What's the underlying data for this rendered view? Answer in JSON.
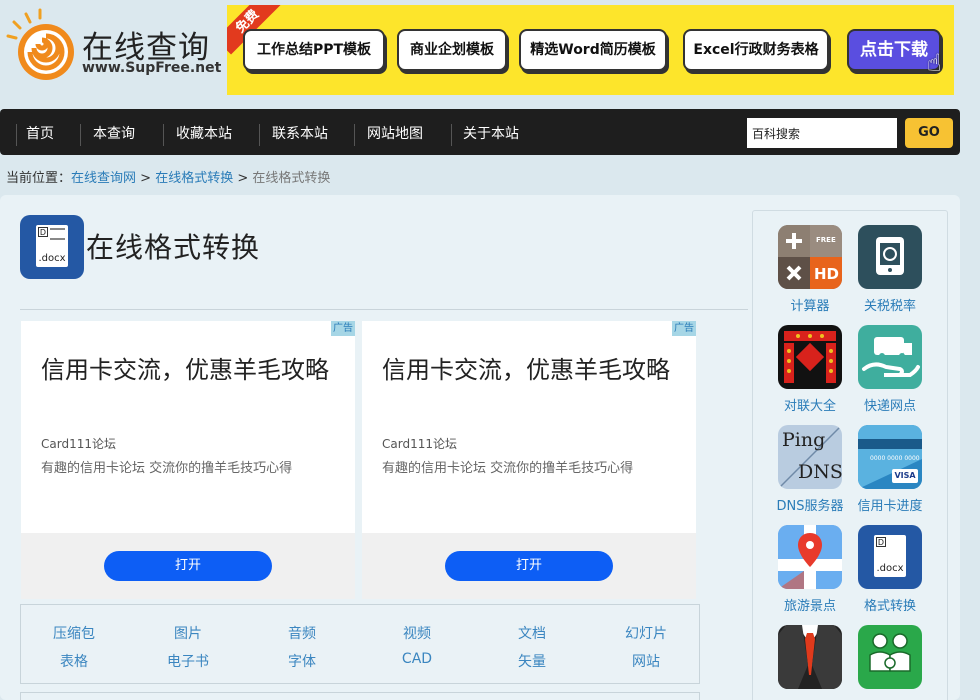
{
  "logo": {
    "title": "在线查询",
    "url": "www.SupFree.net"
  },
  "banner": {
    "badge": "免费",
    "buttons": [
      "工作总结PPT模板",
      "商业企划模板",
      "精选Word简历模板",
      "Excel行政财务表格"
    ],
    "download": "点击下载"
  },
  "nav": {
    "items": [
      "首页",
      "本查询",
      "收藏本站",
      "联系本站",
      "网站地图",
      "关于本站"
    ],
    "search_placeholder": "百科搜索",
    "go": "GO"
  },
  "breadcrumb": {
    "prefix": "当前位置：",
    "links": [
      "在线查询网",
      "在线格式转换"
    ],
    "sep": ">",
    "current": "在线格式转换"
  },
  "page": {
    "title": "在线格式转换",
    "icon_ext": ".docx",
    "icon_letter": "D"
  },
  "ads": [
    {
      "tag": "广告",
      "headline": "信用卡交流，优惠羊毛攻略",
      "source": "Card111论坛",
      "desc": "有趣的信用卡论坛 交流你的撸羊毛技巧心得",
      "button": "打开"
    },
    {
      "tag": "广告",
      "headline": "信用卡交流，优惠羊毛攻略",
      "source": "Card111论坛",
      "desc": "有趣的信用卡论坛 交流你的撸羊毛技巧心得",
      "button": "打开"
    }
  ],
  "categories": [
    "压缩包",
    "图片",
    "音频",
    "视频",
    "文档",
    "幻灯片",
    "表格",
    "电子书",
    "字体",
    "CAD",
    "矢量",
    "网站"
  ],
  "sidebar": {
    "tools": [
      {
        "label": "计算器",
        "icon": "calculator-icon",
        "free": "FREE",
        "hd": "HD"
      },
      {
        "label": "关税税率",
        "icon": "tariff-icon"
      },
      {
        "label": "对联大全",
        "icon": "couplet-icon"
      },
      {
        "label": "快递网点",
        "icon": "express-icon"
      },
      {
        "label": "DNS服务器",
        "icon": "dns-icon",
        "t1": "Ping",
        "t2": "DNS"
      },
      {
        "label": "信用卡进度",
        "icon": "credit-card-icon",
        "visa": "VISA",
        "num": "0000 0000 0000"
      },
      {
        "label": "旅游景点",
        "icon": "map-pin-icon"
      },
      {
        "label": "格式转换",
        "icon": "docx-icon",
        "ext": ".docx",
        "letter": "D"
      },
      {
        "label": "",
        "icon": "suit-tie-icon"
      },
      {
        "label": "",
        "icon": "family-icon"
      }
    ]
  }
}
